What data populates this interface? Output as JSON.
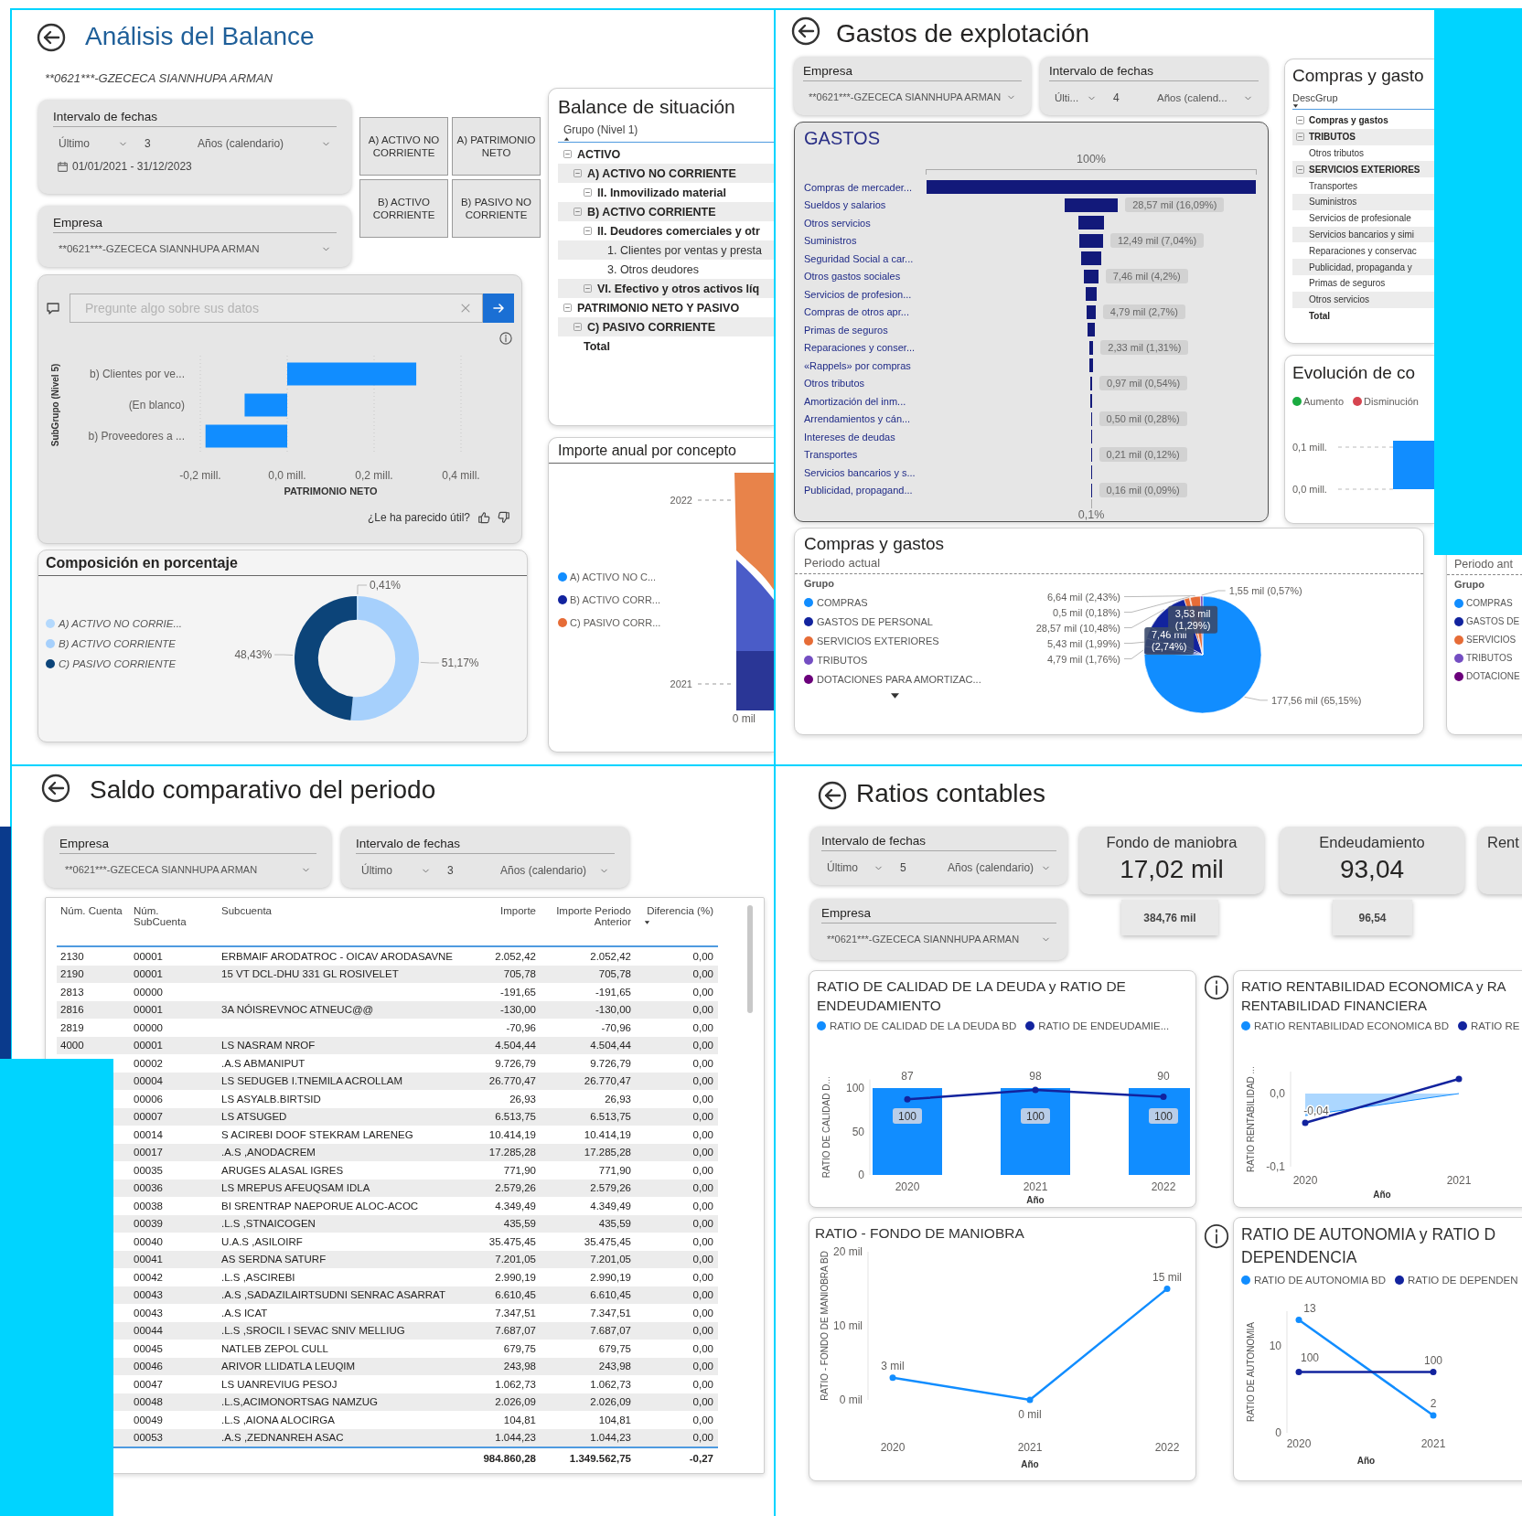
{
  "balance_report": {
    "title": "Análisis del Balance",
    "company_caption": "**0621***-GZECECA SIANNHUPA ARMAN",
    "date_filter": {
      "title": "Intervalo de fechas",
      "mode": "Último",
      "count": "3",
      "unit": "Años (calendario)",
      "range": "01/01/2021 - 31/12/2023"
    },
    "company_filter": {
      "title": "Empresa",
      "value": "**0621***-GZECECA SIANNHUPA ARMAN"
    },
    "nav_buttons": [
      "A) ACTIVO NO CORRIENTE",
      "A) PATRIMONIO NETO",
      "B) ACTIVO CORRIENTE",
      "B) PASIVO NO CORRIENTE"
    ],
    "qa_visual": {
      "placeholder": "Pregunte algo sobre sus datos",
      "feedback": "¿Le ha parecido útil?",
      "chart_data": {
        "type": "bar",
        "orientation": "horizontal",
        "ylabel": "SubGrupo (Nivel 5)",
        "xlabel": "PATRIMONIO NETO",
        "categories": [
          "b) Clientes por ve...",
          "(En blanco)",
          "b) Proveedores a ..."
        ],
        "values": [
          0.297,
          -0.098,
          -0.188
        ],
        "xlim": [
          -0.2,
          0.4
        ],
        "xticks": [
          {
            "value": -0.2,
            "label": "-0,2 mill."
          },
          {
            "value": 0,
            "label": "0,0 mill."
          },
          {
            "value": 0.2,
            "label": "0,2 mill."
          },
          {
            "value": 0.4,
            "label": "0,4 mill."
          }
        ]
      }
    },
    "balance_matrix": {
      "title": "Balance de situación",
      "column": "Grupo (Nivel 1)",
      "sorted_descending": false,
      "rows": [
        {
          "label": "ACTIVO",
          "expanded": true,
          "children": [
            {
              "label": "A) ACTIVO NO CORRIENTE",
              "expanded": true,
              "children": [
                {
                  "label": "II. Inmovilizado material",
                  "expanded": true
                }
              ]
            },
            {
              "label": "B) ACTIVO CORRIENTE",
              "expanded": true,
              "children": [
                {
                  "label": "II. Deudores comerciales y otr",
                  "expanded": true,
                  "children": [
                    {
                      "label": "1. Clientes por ventas y presta"
                    },
                    {
                      "label": "3. Otros deudores"
                    }
                  ]
                },
                {
                  "label": "VI. Efectivo y otros activos líq",
                  "expanded": true
                }
              ]
            }
          ]
        },
        {
          "label": "PATRIMONIO NETO Y PASIVO",
          "expanded": true,
          "children": [
            {
              "label": "C) PASIVO CORRIENTE",
              "expanded": true
            }
          ]
        }
      ],
      "total": "Total"
    },
    "composition": {
      "title": "Composición en porcentaje",
      "legend": [
        {
          "label": "A) ACTIVO NO CORRIE...",
          "color": "#b4d9fd"
        },
        {
          "label": "B) ACTIVO CORRIENTE",
          "color": "#a6d0fc"
        },
        {
          "label": "C) PASIVO CORRIENTE",
          "color": "#0c4479"
        }
      ],
      "chart_data": {
        "type": "donut",
        "values": [
          0.41,
          51.17,
          48.43
        ],
        "value_labels": [
          "0,41%",
          "51,17%",
          "48,43%"
        ]
      }
    },
    "annual_chart": {
      "title": "Importe anual por concepto",
      "legend": [
        {
          "label": "A) ACTIVO NO C...",
          "color": "#118dff"
        },
        {
          "label": "B) ACTIVO CORR...",
          "color": "#12239e"
        },
        {
          "label": "C) PASIVO CORR...",
          "color": "#e66c37"
        }
      ],
      "y_labels": [
        "2022",
        "2021"
      ],
      "x_label": "0 mil"
    }
  },
  "expenses_report": {
    "title": "Gastos de explotación",
    "company_filter": {
      "title": "Empresa",
      "value": "**0621***-GZECECA SIANNHUPA ARMAN"
    },
    "date_filter": {
      "title": "Intervalo de fechas",
      "mode": "Últi...",
      "count": "4",
      "unit": "Años (calend..."
    },
    "funnel": {
      "title": "GASTOS",
      "top_label": "100%",
      "bottom_label": "0,1%",
      "items": [
        {
          "name": "Compras de mercader..."
        },
        {
          "name": "Sueldos y salarios",
          "label": "28,57 mil (16,09%)"
        },
        {
          "name": "Otros servicios"
        },
        {
          "name": "Suministros",
          "label": "12,49 mil (7,04%)"
        },
        {
          "name": "Seguridad Social a car..."
        },
        {
          "name": "Otros gastos sociales",
          "label": "7,46 mil (4,2%)"
        },
        {
          "name": "Servicios de profesion..."
        },
        {
          "name": "Compras de otros apr...",
          "label": "4,79 mil (2,7%)"
        },
        {
          "name": "Primas de seguros"
        },
        {
          "name": "Reparaciones y conser...",
          "label": "2,33 mil (1,31%)"
        },
        {
          "name": "«Rappels» por compras"
        },
        {
          "name": "Otros tributos",
          "label": "0,97 mil (0,54%)"
        },
        {
          "name": "Amortización del inm..."
        },
        {
          "name": "Arrendamientos y cán...",
          "label": "0,50 mil (0,28%)"
        },
        {
          "name": "Intereses de deudas"
        },
        {
          "name": "Transportes",
          "label": "0,21 mil (0,12%)"
        },
        {
          "name": "Servicios bancarios y s..."
        },
        {
          "name": "Publicidad, propagand...",
          "label": "0,16 mil (0,09%)"
        }
      ]
    },
    "expense_matrix": {
      "title": "Compras y gasto",
      "column": "DescGrup",
      "sorted_descending": true,
      "rows": [
        {
          "label": "Compras y gastos",
          "expanded": true
        },
        {
          "label": "TRIBUTOS",
          "expanded": true,
          "children": [
            {
              "label": "Otros tributos"
            }
          ]
        },
        {
          "label": "SERVICIOS EXTERIORES",
          "expanded": true,
          "children": [
            {
              "label": "Transportes"
            },
            {
              "label": "Suministros"
            },
            {
              "label": "Servicios de profesionale"
            },
            {
              "label": "Servicios bancarios y simi"
            },
            {
              "label": "Reparaciones y conservac"
            },
            {
              "label": "Publicidad, propaganda y"
            },
            {
              "label": "Primas de seguros"
            },
            {
              "label": "Otros servicios"
            }
          ]
        }
      ],
      "total": "Total"
    },
    "evolution": {
      "title": "Evolución de co",
      "legend": [
        {
          "label": "Aumento",
          "color": "#1aab40"
        },
        {
          "label": "Disminución",
          "color": "#d64550"
        }
      ],
      "y_labels": [
        "0,1 mill.",
        "0,0 mill."
      ]
    },
    "pie_chart": {
      "title": "Compras y gastos",
      "subtitle": "Periodo actual",
      "legend": {
        "title": "Grupo",
        "items": [
          {
            "label": "COMPRAS",
            "color": "#118dff"
          },
          {
            "label": "GASTOS DE PERSONAL",
            "color": "#12239e"
          },
          {
            "label": "SERVICIOS EXTERIORES",
            "color": "#e66c37"
          },
          {
            "label": "TRIBUTOS",
            "color": "#744ec2"
          },
          {
            "label": "DOTACIONES PARA AMORTIZAC...",
            "color": "#6b007b"
          }
        ]
      },
      "chart_data": {
        "type": "pie",
        "values": [
          65.15,
          1.76,
          1.99,
          2.74,
          10.48,
          1.29,
          0.18,
          2.43,
          0.57
        ],
        "value_labels": [
          "177,56 mil (65,15%)",
          "4,79 mil (1,76%)",
          "5,43 mil (1,99%)",
          "7,46 mil (2,74%)",
          "28,57 mil (10,48%)",
          "3,53 mil (1,29%)",
          "0,5 mil (0,18%)",
          "6,64 mil (2,43%)",
          "1,55 mil (0,57%)"
        ]
      }
    },
    "previous_pie": {
      "subtitle": "Periodo ant",
      "legend": {
        "title": "Grupo",
        "items": [
          {
            "label": "COMPRAS",
            "color": "#118dff"
          },
          {
            "label": "GASTOS DE",
            "color": "#12239e"
          },
          {
            "label": "SERVICIOS",
            "color": "#e66c37"
          },
          {
            "label": "TRIBUTOS",
            "color": "#744ec2"
          },
          {
            "label": "DOTACIONE",
            "color": "#6b007b"
          }
        ]
      }
    }
  },
  "balance_comparison": {
    "title": "Saldo comparativo del periodo",
    "company_filter": {
      "title": "Empresa",
      "value": "**0621***-GZECECA SIANNHUPA ARMAN"
    },
    "date_filter": {
      "title": "Intervalo de fechas",
      "mode": "Último",
      "count": "3",
      "unit": "Años (calendario)"
    },
    "table": {
      "columns": [
        {
          "label": "Núm. Cuenta",
          "sorted": false
        },
        {
          "label": "Núm. SubCuenta",
          "sorted": false
        },
        {
          "label": "Subcuenta",
          "sorted": false
        },
        {
          "label": "Importe",
          "sorted": false
        },
        {
          "label": "Importe Periodo Anterior",
          "sorted": false
        },
        {
          "label": "Diferencia (%)",
          "sorted": true,
          "descending": true
        }
      ],
      "rows": [
        {
          "account": "2130",
          "sub": "00001",
          "name": "ERBMAIF ARODATROC - OICAV ARODASAVNE",
          "amount": "2.052,42",
          "previous": "2.052,42",
          "diff": "0,00"
        },
        {
          "account": "2190",
          "sub": "00001",
          "name": "15 VT DCL-DHU 331 GL ROSIVELET",
          "amount": "705,78",
          "previous": "705,78",
          "diff": "0,00"
        },
        {
          "account": "2813",
          "sub": "00000",
          "amount": "-191,65",
          "previous": "-191,65",
          "diff": "0,00"
        },
        {
          "account": "2816",
          "sub": "00001",
          "name": "3A NÓISREVNOC ATNEUC@@",
          "amount": "-130,00",
          "previous": "-130,00",
          "diff": "0,00"
        },
        {
          "account": "2819",
          "sub": "00000",
          "amount": "-70,96",
          "previous": "-70,96",
          "diff": "0,00"
        },
        {
          "account": "4000",
          "sub": "00001",
          "name": "LS NASRAM NROF",
          "amount": "4.504,44",
          "previous": "4.504,44",
          "diff": "0,00"
        },
        {
          "sub": "00002",
          "name": ".A.S ABMANIPUT",
          "amount": "9.726,79",
          "previous": "9.726,79",
          "diff": "0,00"
        },
        {
          "sub": "00004",
          "name": "LS SEDUGEB I.TNEMILA ACROLLAM",
          "amount": "26.770,47",
          "previous": "26.770,47",
          "diff": "0,00"
        },
        {
          "sub": "00006",
          "name": "LS ASYALB.BIRTSID",
          "amount": "26,93",
          "previous": "26,93",
          "diff": "0,00"
        },
        {
          "sub": "00007",
          "name": "LS ATSUGED",
          "amount": "6.513,75",
          "previous": "6.513,75",
          "diff": "0,00"
        },
        {
          "sub": "00014",
          "name": "S ACIREBI DOOF STEKRAM LARENEG",
          "amount": "10.414,19",
          "previous": "10.414,19",
          "diff": "0,00"
        },
        {
          "sub": "00017",
          "name": ".A.S ,ANODACREM",
          "amount": "17.285,28",
          "previous": "17.285,28",
          "diff": "0,00"
        },
        {
          "sub": "00035",
          "name": "ARUGES ALASAL IGRES",
          "amount": "771,90",
          "previous": "771,90",
          "diff": "0,00"
        },
        {
          "sub": "00036",
          "name": "LS MREPUS AFEUQSAM IDLA",
          "amount": "2.579,26",
          "previous": "2.579,26",
          "diff": "0,00"
        },
        {
          "sub": "00038",
          "name": "BI SRENTRAP NAEPORUE ALOC-ACOC",
          "amount": "4.349,49",
          "previous": "4.349,49",
          "diff": "0,00"
        },
        {
          "sub": "00039",
          "name": ".L.S ,STNAICOGEN",
          "amount": "435,59",
          "previous": "435,59",
          "diff": "0,00"
        },
        {
          "sub": "00040",
          "name": "U.A.S ,ASILOIRF",
          "amount": "35.475,45",
          "previous": "35.475,45",
          "diff": "0,00"
        },
        {
          "sub": "00041",
          "name": "AS SERDNA SATURF",
          "amount": "7.201,05",
          "previous": "7.201,05",
          "diff": "0,00"
        },
        {
          "sub": "00042",
          "name": ".L.S ,ASCIREBI",
          "amount": "2.990,19",
          "previous": "2.990,19",
          "diff": "0,00"
        },
        {
          "sub": "00043",
          "name": ".A.S ,SADAZILAIRTSUDNI SENRAC ASARRAT",
          "amount": "6.610,45",
          "previous": "6.610,45",
          "diff": "0,00"
        },
        {
          "sub": "00043",
          "name": ".A.S ICAT",
          "amount": "7.347,51",
          "previous": "7.347,51",
          "diff": "0,00"
        },
        {
          "sub": "00044",
          "name": ".L.S ,SROCIL I SEVAC SNIV MELLIUG",
          "amount": "7.687,07",
          "previous": "7.687,07",
          "diff": "0,00"
        },
        {
          "sub": "00045",
          "name": "NATLEB ZEPOL CULL",
          "amount": "679,75",
          "previous": "679,75",
          "diff": "0,00"
        },
        {
          "sub": "00046",
          "name": "ARIVOR LLIDATLA LEUQIM",
          "amount": "243,98",
          "previous": "243,98",
          "diff": "0,00"
        },
        {
          "sub": "00047",
          "name": "LS UANREVIUG PESOJ",
          "amount": "1.062,73",
          "previous": "1.062,73",
          "diff": "0,00"
        },
        {
          "sub": "00048",
          "name": ".L.S,ACIMONORTSAG NAMZUG",
          "amount": "2.026,09",
          "previous": "2.026,09",
          "diff": "0,00"
        },
        {
          "sub": "00049",
          "name": ".L.S ,AIONA ALOCIRGA",
          "amount": "104,81",
          "previous": "104,81",
          "diff": "0,00"
        },
        {
          "sub": "00053",
          "name": ".A.S ,ZEDNANREH ASAC",
          "amount": "1.044,23",
          "previous": "1.044,23",
          "diff": "0,00"
        }
      ],
      "totals": {
        "amount": "984.860,28",
        "previous": "1.349.562,75",
        "diff": "-0,27"
      }
    }
  },
  "ratios_report": {
    "title": "Ratios contables",
    "date_filter": {
      "title": "Intervalo de fechas",
      "mode": "Último",
      "count": "5",
      "unit": "Años (calendario)"
    },
    "company_filter": {
      "title": "Empresa",
      "value": "**0621***-GZECECA SIANNHUPA ARMAN"
    },
    "kpis": [
      {
        "title": "Fondo de maniobra",
        "value": "17,02 mil",
        "reference": "384,76 mil"
      },
      {
        "title": "Endeudamiento",
        "value": "93,04",
        "reference": "96,54"
      },
      {
        "title": "Rent"
      }
    ],
    "charts": [
      {
        "title_lines": [
          "RATIO DE CALIDAD DE LA DEUDA y RATIO DE ENDEUDAMIENTO"
        ],
        "chart_data": {
          "type": "bar",
          "xlabel": "Año",
          "ylabel": "RATIO DE CALIDAD D...",
          "categories": [
            "2020",
            "2021",
            "2022"
          ],
          "ylim": [
            0,
            110
          ],
          "yticks": [
            0,
            50,
            100
          ],
          "series": [
            {
              "name": "RATIO DE CALIDAD DE LA DEUDA BD",
              "color": "#118dff",
              "values": [
                100,
                100,
                100
              ],
              "value_labels": [
                "100",
                "100",
                "100"
              ]
            },
            {
              "name": "RATIO DE ENDEUDAMIE...",
              "color": "#12239e",
              "type": "line",
              "marker": true,
              "values": [
                87,
                98,
                90
              ],
              "value_labels": [
                "87",
                "98",
                "90"
              ]
            }
          ]
        }
      },
      {
        "title_lines": [
          "RATIO RENTABILIDAD ECONOMICA y RA",
          "RENTABILIDAD FINANCIERA"
        ],
        "info": true,
        "chart_data": {
          "type": "area",
          "xlabel": "Año",
          "ylabel": "RATIO RENTABILIDAD ...",
          "categories": [
            "2020",
            "2021"
          ],
          "ylim": [
            -0.1,
            0.03
          ],
          "yticks": [
            {
              "value": 0,
              "label": "0,0"
            },
            {
              "value": -0.1,
              "label": "-0,1"
            }
          ],
          "series": [
            {
              "name": "RATIO RENTABILIDAD ECONOMICA BD",
              "color": "#118dff",
              "values": [
                -0.03,
                0.0
              ]
            },
            {
              "name": "RATIO RE",
              "color": "#12239e",
              "type": "line",
              "marker": true,
              "values": [
                -0.04,
                0.02
              ],
              "value_labels": [
                "-0,04",
                null
              ]
            }
          ]
        }
      },
      {
        "title_lines": [
          "RATIO - FONDO DE MANIOBRA"
        ],
        "chart_data": {
          "type": "line",
          "xlabel": "Año",
          "ylabel": "RATIO - FONDO DE MANIOBRA BD",
          "categories": [
            "2020",
            "2021",
            "2022"
          ],
          "ylim": [
            0,
            20
          ],
          "yticks": [
            {
              "value": 0,
              "label": "0 mil"
            },
            {
              "value": 10,
              "label": "10 mil"
            },
            {
              "value": 20,
              "label": "20 mil"
            }
          ],
          "series": [
            {
              "color": "#118dff",
              "marker": true,
              "values": [
                3,
                0,
                15
              ],
              "value_labels": [
                "3 mil",
                "0 mil",
                "15 mil"
              ]
            }
          ]
        }
      },
      {
        "title_lines": [
          "RATIO DE AUTONOMIA y RATIO D",
          "DEPENDENCIA"
        ],
        "info": true,
        "chart_data": {
          "type": "line",
          "xlabel": "Año",
          "ylabel": "RATIO DE AUTONOMIA",
          "categories": [
            "2020",
            "2021"
          ],
          "ylim": [
            0,
            14
          ],
          "yticks": [
            0,
            10
          ],
          "annotations": [
            "100",
            "100"
          ],
          "series": [
            {
              "name": "RATIO DE AUTONOMIA BD",
              "color": "#118dff",
              "marker": true,
              "values": [
                13,
                2
              ],
              "value_labels": [
                "13",
                "2"
              ]
            },
            {
              "name": "RATIO DE DEPENDEN",
              "color": "#12239e",
              "values": [
                null,
                null
              ]
            }
          ]
        }
      }
    ]
  }
}
